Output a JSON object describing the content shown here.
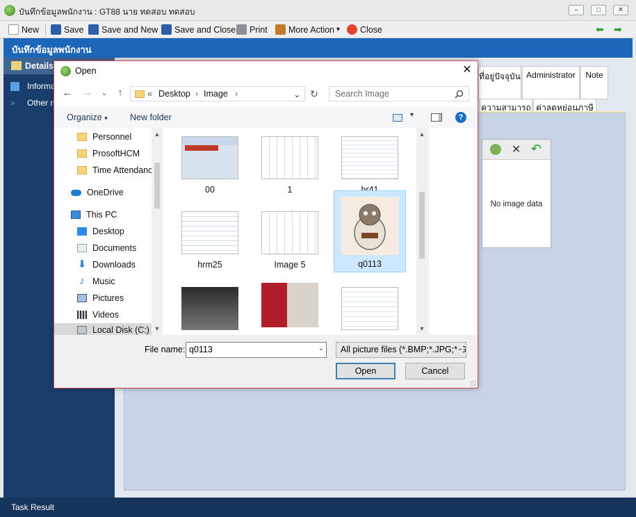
{
  "window": {
    "title": "บันทึกข้อมูลพนักงาน : GT88 นาย ทดสอบ ทดสอบ",
    "min": "–",
    "max": "□",
    "close": "✕"
  },
  "toolbar": {
    "new": "New",
    "save": "Save",
    "save_new": "Save and New",
    "save_close": "Save and Close",
    "print": "Print",
    "more": "More Action",
    "more_arrow": "▾",
    "close": "Close",
    "back": "⬅",
    "forward": "➡"
  },
  "header": {
    "title": "บันทึกข้อมูลพนักงาน"
  },
  "leftnav": {
    "details": "Details",
    "items": [
      {
        "label": "Information"
      },
      {
        "label": "Other menu"
      }
    ]
  },
  "tabs": {
    "row1": [
      "ที่อยู่ปัจจุบัน",
      "Administrator",
      "Note"
    ],
    "row2": [
      "ความสามารถ",
      "ค่าลดหย่อนภาษี"
    ]
  },
  "image_panel": {
    "no_image": "No image data",
    "remove": "✕",
    "undo": "↶"
  },
  "status": {
    "text": "Task Result"
  },
  "dialog": {
    "title": "Open",
    "close": "✕",
    "nav": {
      "back": "←",
      "forward": "→",
      "recent": "⌄",
      "up": "↑",
      "refresh": "↻"
    },
    "breadcrumb": {
      "overflow": "«",
      "sep1": "›",
      "folder1": "Desktop",
      "sep2": "›",
      "folder2": "Image",
      "sep3": "›",
      "dropdown": "⌄"
    },
    "search_placeholder": "Search Image",
    "organize": "Organize",
    "organize_arrow": "▾",
    "new_folder": "New folder",
    "view_arrow": "▾",
    "help": "?",
    "tree": [
      {
        "label": "Personnel",
        "kind": "folder"
      },
      {
        "label": "ProsoftHCM",
        "kind": "folder"
      },
      {
        "label": "Time Attendance",
        "kind": "folder"
      },
      {
        "label": "OneDrive",
        "kind": "cloud"
      },
      {
        "label": "This PC",
        "kind": "pc"
      },
      {
        "label": "Desktop",
        "kind": "desktop"
      },
      {
        "label": "Documents",
        "kind": "docs"
      },
      {
        "label": "Downloads",
        "kind": "down"
      },
      {
        "label": "Music",
        "kind": "music"
      },
      {
        "label": "Pictures",
        "kind": "pics"
      },
      {
        "label": "Videos",
        "kind": "videos"
      },
      {
        "label": "Local Disk (C:)",
        "kind": "disk"
      }
    ],
    "files": [
      {
        "name": "00"
      },
      {
        "name": "1"
      },
      {
        "name": "hr41"
      },
      {
        "name": "hrm25"
      },
      {
        "name": "Image 5"
      },
      {
        "name": "q0113",
        "selected": true
      },
      {
        "name": ""
      },
      {
        "name": ""
      },
      {
        "name": ""
      }
    ],
    "file_name_label": "File name:",
    "file_name_value": "q0113",
    "filter_value": "All picture files (*.BMP;*.JPG;*.GIF;*.PNG)",
    "open": "Open",
    "cancel": "Cancel",
    "dropdown_arrow": "⌄"
  },
  "colors": {
    "header_blue": "#1e66b8",
    "nav_dark": "#1a3e6c",
    "selection": "#cce8ff",
    "dialog_border": "#d24b57"
  }
}
